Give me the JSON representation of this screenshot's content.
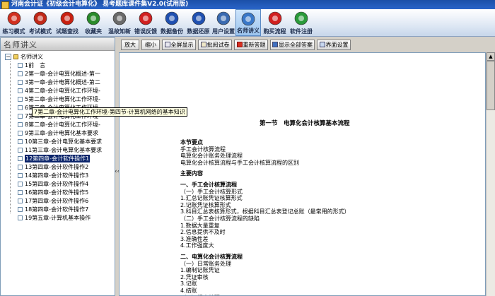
{
  "window": {
    "title": "河南会计证《初级会计电算化》 易考题库课件集V2.0(试用版)"
  },
  "toolbar": {
    "items": [
      {
        "label": "练习模式",
        "icon": "practice-icon",
        "color": "#d03020"
      },
      {
        "label": "考试模式",
        "icon": "exam-icon",
        "color": "#c02818"
      },
      {
        "label": "试题查找",
        "icon": "search-questions-icon",
        "color": "#c82010"
      },
      {
        "label": "收藏夹",
        "icon": "favorites-icon",
        "color": "#2a8a2a"
      },
      {
        "label": "温故知新",
        "icon": "review-icon",
        "color": "#6a6a6a"
      },
      {
        "label": "错误反馈",
        "icon": "error-feedback-icon",
        "color": "#d02020"
      },
      {
        "label": "数据备份",
        "icon": "backup-icon",
        "color": "#2050b0"
      },
      {
        "label": "数据还原",
        "icon": "restore-icon",
        "color": "#2050b0"
      },
      {
        "label": "用户设置",
        "icon": "settings-icon",
        "color": "#3a6ab0"
      },
      {
        "label": "名师讲义",
        "icon": "lecture-notes-icon",
        "color": "#3a78c8"
      },
      {
        "label": "购买流程",
        "icon": "purchase-icon",
        "color": "#d02020"
      },
      {
        "label": "软件注册",
        "icon": "register-icon",
        "color": "#2a9a3a"
      }
    ],
    "active_index": 9
  },
  "left_panel": {
    "header": "名师讲义",
    "root": "名师讲义",
    "items": [
      "1前　言",
      "2第一章-会计电算化概述-第一",
      "3第一章-会计电算化概述-第二",
      "4第二章-会计电算化工作环境-",
      "5第二章-会计电算化工作环境-",
      "6第二章-会计电算化工作环境-",
      "7第二章-会计电算化工作环境-",
      "8第二章-会计电算化工作环境-",
      "9第三章-会计电算化基本要求",
      "10第三章-会计电算化基本要求",
      "11第三章-会计电算化基本要求",
      "12第四章-会计软件操作1",
      "13第四章-会计软件操作2",
      "14第四章-会计软件操作3",
      "15第四章-会计软件操作4",
      "16第四章-会计软件操作5",
      "17第四章-会计软件操作6",
      "18第四章-会计软件操作7",
      "19第五章-计算机基本操作"
    ],
    "selected_index": 11,
    "tooltip": "7第二章-会计电算化工作环境-第四节-计算机网络的基本知识"
  },
  "splitter_glyph": "‹‹",
  "buttons": {
    "zoom_in": "放大",
    "zoom_out": "缩小",
    "fullscreen": "全屏显示",
    "grade": "批阅试卷",
    "rewrite": "重新答题",
    "show_answers": "显示全部答案",
    "ui_settings": "界面设置"
  },
  "document": {
    "title": "第一节　电算化会计核算基本流程",
    "lines": [
      {
        "text": "本节要点",
        "bold": true
      },
      {
        "text": "手工会计核算流程",
        "bold": false
      },
      {
        "text": "电算化会计账务处理流程",
        "bold": false
      },
      {
        "text": "电算化会计核算流程与手工会计核算流程的区别",
        "bold": false
      },
      {
        "text": "",
        "bold": false
      },
      {
        "text": "主要内容",
        "bold": true
      },
      {
        "text": "",
        "bold": false
      },
      {
        "text": "一、手工会计核算流程",
        "bold": true
      },
      {
        "text": "（一）手工会计核算形式",
        "bold": false
      },
      {
        "text": "1.汇总记账凭证核算形式",
        "bold": false
      },
      {
        "text": "2.记账凭证核算形式",
        "bold": false
      },
      {
        "text": "3.科目汇总表核算形式，根据科目汇总表登记总账（最常用的形式）",
        "bold": false
      },
      {
        "text": "（二）手工会计核算流程的缺陷",
        "bold": false
      },
      {
        "text": "1.数据大量重复",
        "bold": false
      },
      {
        "text": "2.信息提供不及时",
        "bold": false
      },
      {
        "text": "3.准确性差",
        "bold": false
      },
      {
        "text": "4.工作强度大",
        "bold": false
      },
      {
        "text": "",
        "bold": false
      },
      {
        "text": "二、电算化会计核算流程",
        "bold": true
      },
      {
        "text": "（一）日常账务处理",
        "bold": false
      },
      {
        "text": "1.编制记账凭证",
        "bold": false
      },
      {
        "text": "2.凭证审核",
        "bold": false
      },
      {
        "text": "3.记账",
        "bold": false
      },
      {
        "text": "4.结账",
        "bold": false
      },
      {
        "text": "（二）报表处理",
        "bold": false
      }
    ]
  }
}
